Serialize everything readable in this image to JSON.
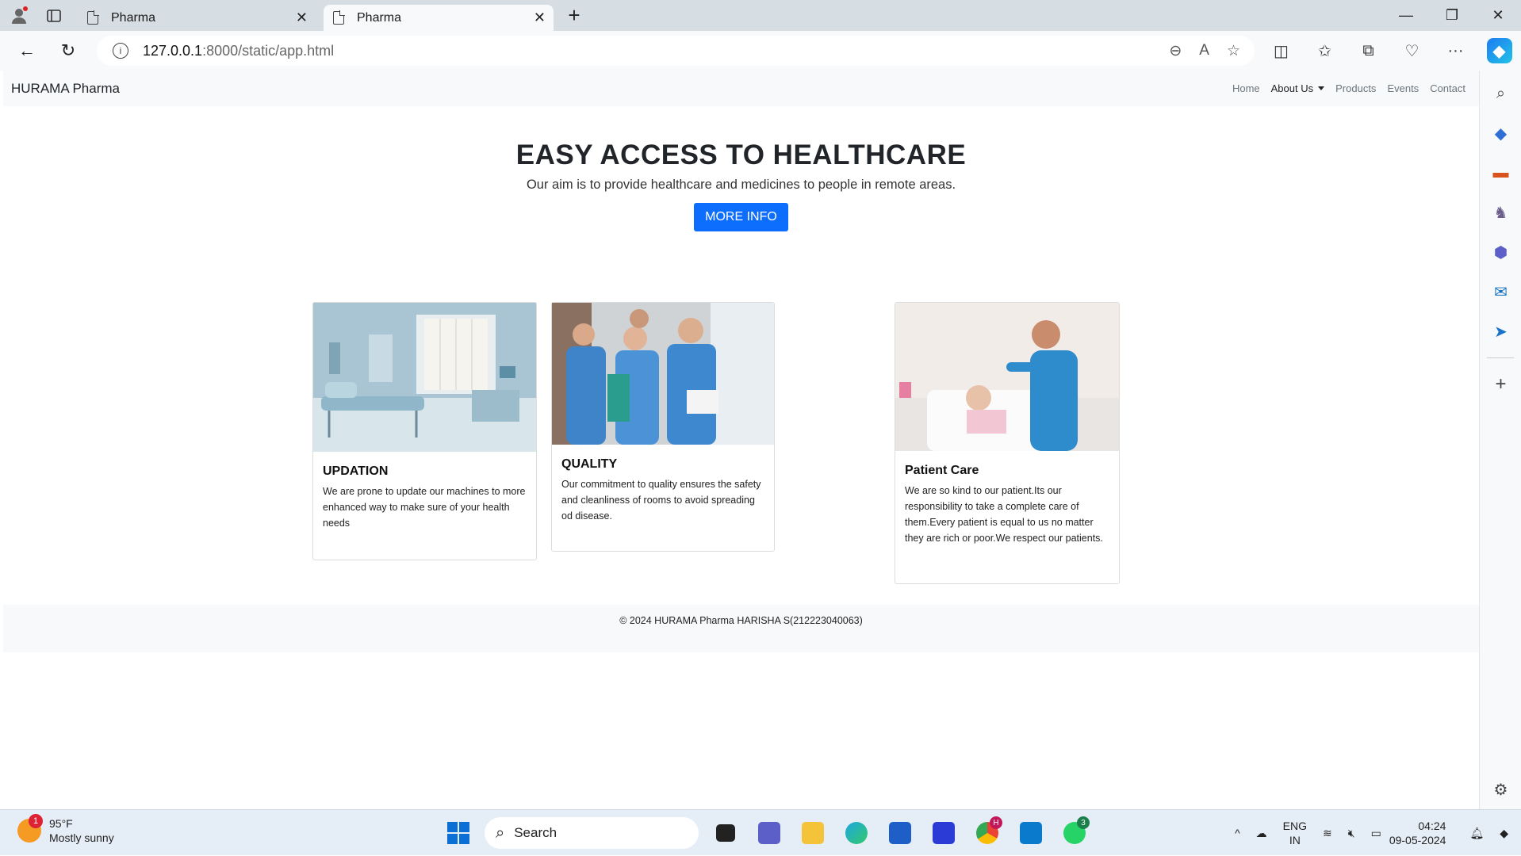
{
  "browser": {
    "tabs": [
      {
        "title": "Pharma",
        "active": false
      },
      {
        "title": "Pharma",
        "active": true
      }
    ],
    "url_host": "127.0.0.1",
    "url_path": ":8000/static/app.html"
  },
  "site": {
    "brand": "HURAMA Pharma",
    "nav": [
      "Home",
      "About Us",
      "Products",
      "Events",
      "Contact"
    ],
    "hero": {
      "title": "EASY ACCESS TO HEALTHCARE",
      "subtitle": "Our aim is to provide healthcare and medicines to people in remote areas.",
      "button": "MORE INFO"
    },
    "cards": [
      {
        "title": "UPDATION",
        "text": "We are prone to update our machines to more enhanced way to make sure of your health needs",
        "image": "hospital-room-image"
      },
      {
        "title": "QUALITY",
        "text": "Our commitment to quality ensures the safety and cleanliness of rooms to avoid spreading od disease.",
        "image": "medical-staff-image"
      },
      {
        "title": "Patient Care",
        "text": "We are so kind to our patient.Its our responsibility to take a complete care of them.Every patient is equal to us no matter they are rich or poor.We respect our patients.",
        "image": "nurse-patient-image"
      }
    ],
    "footer": "© 2024 HURAMA Pharma HARISHA S(212223040063)"
  },
  "taskbar": {
    "weather_temp": "95°F",
    "weather_desc": "Mostly sunny",
    "weather_badge": "1",
    "search_placeholder": "Search",
    "lang_line1": "ENG",
    "lang_line2": "IN",
    "time": "04:24",
    "date": "09-05-2024",
    "whatsapp_badge": "3",
    "chrome_badge": "H"
  },
  "colors": {
    "primary": "#0d6efd",
    "navbar_bg": "#f8f9fa"
  }
}
